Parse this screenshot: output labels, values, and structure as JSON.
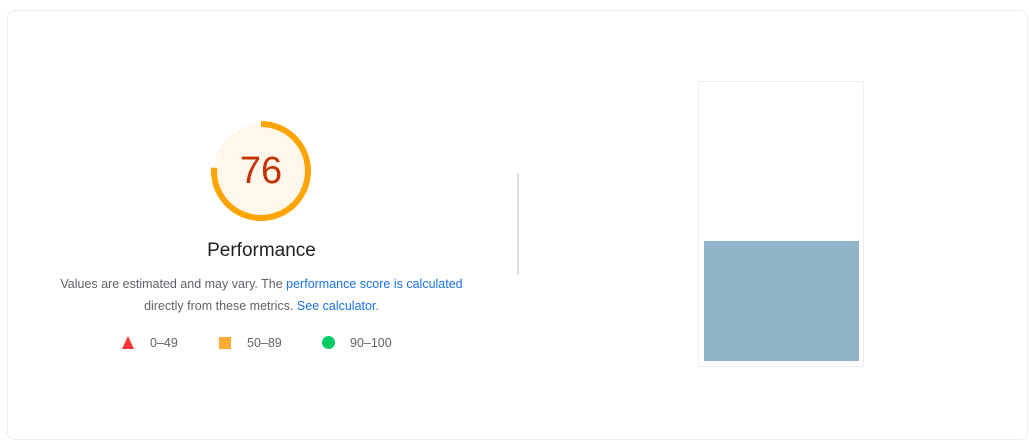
{
  "score": {
    "value": "76",
    "fraction": 0.76,
    "ring_color": "#ffa400",
    "fill_color": "#fff7ec",
    "text_color": "#c33300"
  },
  "category": {
    "title": "Performance"
  },
  "description": {
    "prefix": "Values are estimated and may vary. The ",
    "link1": "performance score is calculated",
    "middle": "directly from these metrics. ",
    "link2": "See calculator",
    "suffix": "."
  },
  "legend": [
    {
      "shape": "triangle",
      "color": "#ff3333",
      "label": "0–49"
    },
    {
      "shape": "square",
      "color": "#ffaa33",
      "label": "50–89"
    },
    {
      "shape": "circle",
      "color": "#00cc66",
      "label": "90–100"
    }
  ],
  "screenshot": {
    "block_color": "#91b3c7"
  }
}
